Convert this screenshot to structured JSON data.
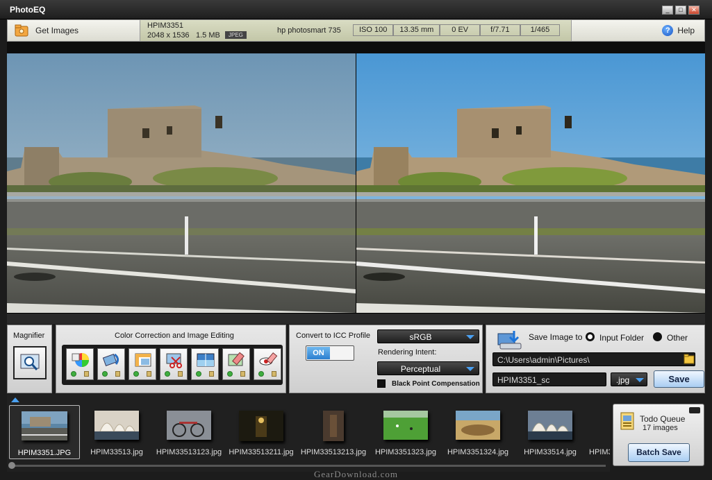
{
  "window": {
    "title": "PhotoEQ"
  },
  "toolbar": {
    "get_images": "Get Images",
    "help": "Help"
  },
  "exif": {
    "filename": "HPIM3351",
    "dimensions": "2048 x 1536",
    "filesize": "1.5 MB",
    "format": "JPEG",
    "camera": "hp photosmart 735",
    "iso": "ISO 100",
    "focal_length": "13.35 mm",
    "exposure_comp": "0 EV",
    "aperture": "f/7.71",
    "shutter": "1/465"
  },
  "magnifier": {
    "title": "Magnifier"
  },
  "color_correction": {
    "title": "Color Correction and Image Editing"
  },
  "icc": {
    "title": "Convert to ICC Profile",
    "toggle": "ON",
    "profile": "sRGB",
    "rendering_intent_label": "Rendering Intent:",
    "rendering_intent": "Perceptual",
    "black_point": "Black Point Compensation"
  },
  "save": {
    "label": "Save Image to",
    "opt_input": "Input Folder",
    "opt_other": "Other",
    "selected": "Input Folder",
    "path": "C:\\Users\\admin\\Pictures\\",
    "filename": "HPIM3351_sc",
    "ext": ".jpg",
    "button": "Save"
  },
  "filmstrip": {
    "items": [
      {
        "name": "HPIM3351.JPG"
      },
      {
        "name": "HPIM33513.jpg"
      },
      {
        "name": "HPIM33513123.jpg"
      },
      {
        "name": "HPIM33513211.jpg"
      },
      {
        "name": "HPIM33513213.jpg"
      },
      {
        "name": "HPIM3351323.jpg"
      },
      {
        "name": "HPIM3351324.jpg"
      },
      {
        "name": "HPIM33514.jpg"
      },
      {
        "name": "HPIM3"
      }
    ]
  },
  "queue": {
    "title": "Todo Queue",
    "count": "17 images",
    "button": "Batch Save"
  },
  "watermark": "GearDownload.com"
}
